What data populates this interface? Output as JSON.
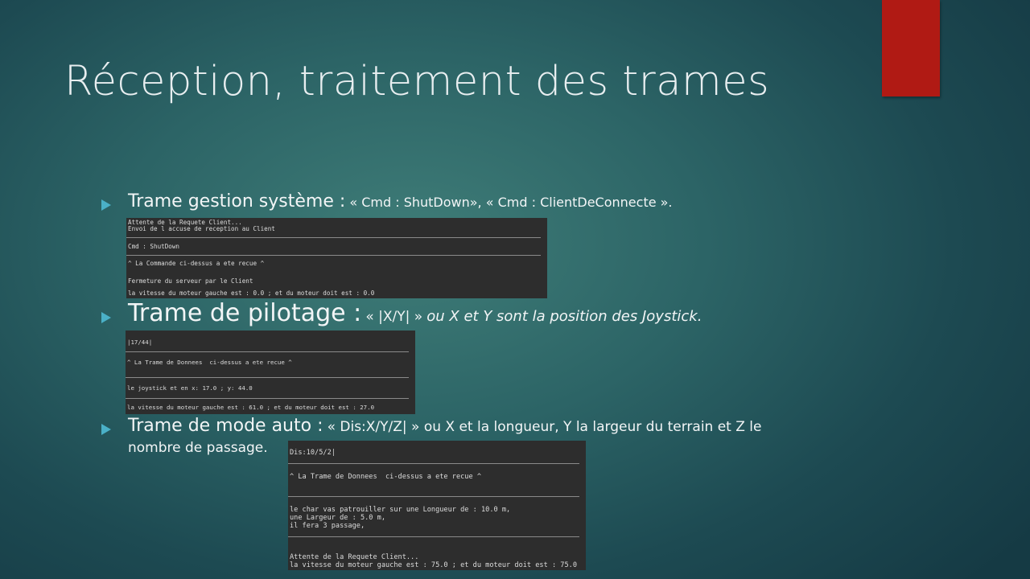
{
  "slide": {
    "title": "Réception, traitement des trames",
    "accent_color": "#b01a14",
    "bullet_color": "#4ab0c7"
  },
  "items": [
    {
      "label": "Trame gestion système :",
      "detail": "« Cmd : ShutDown», « Cmd : ClientDeConnecte ».",
      "console": [
        "Attente de la Requete Client...",
        "Envoi de l accuse de reception au Client",
        "Cmd : ShutDown",
        "^ La Commande ci-dessus a ete recue ^",
        "Fermeture du serveur par le Client",
        "la vitesse du moteur gauche est : 0.0 ; et du moteur doit est : 0.0"
      ]
    },
    {
      "label": "Trame de pilotage :",
      "detail_a": "« |X/Y| »",
      "detail_b": "ou X et Y sont la position des Joystick.",
      "console": [
        "|17/44|",
        "^ La Trame de Donnees  ci-dessus a ete recue ^",
        "le joystick et en x: 17.0 ; y: 44.0",
        "la vitesse du moteur gauche est : 61.0 ; et du moteur doit est : 27.0"
      ]
    },
    {
      "label": "Trame de mode auto :",
      "detail": "« Dis:X/Y/Z| » ou X et la longueur, Y la largeur du terrain et Z le",
      "detail_cont": "nombre de passage.",
      "console": [
        "Dis:10/5/2|",
        "^ La Trame de Donnees  ci-dessus a ete recue ^",
        "le char vas patrouiller sur une Longueur de : 10.0 m,",
        "une Largeur de : 5.0 m,",
        "il fera 3 passage,",
        "Attente de la Requete Client...",
        "la vitesse du moteur gauche est : 75.0 ; et du moteur doit est : 75.0"
      ]
    }
  ]
}
